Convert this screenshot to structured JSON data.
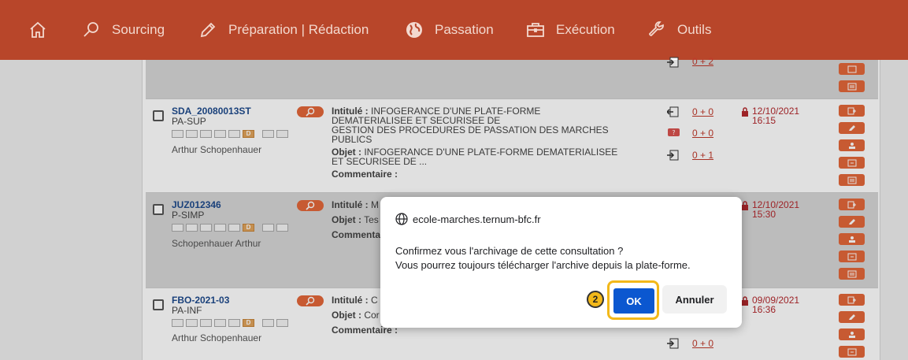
{
  "nav": {
    "items": [
      {
        "label": "Sourcing",
        "icon": "search-icon"
      },
      {
        "label": "Préparation | Rédaction",
        "icon": "pencil-icon"
      },
      {
        "label": "Passation",
        "icon": "globe-icon"
      },
      {
        "label": "Exécution",
        "icon": "briefcase-icon"
      },
      {
        "label": "Outils",
        "icon": "wrench-icon"
      }
    ]
  },
  "rows": [
    {
      "ref": "SDA_20080013ST",
      "proc": "PA-SUP",
      "author": "Arthur Schopenhauer",
      "intitule_label": "Intitulé :",
      "intitule_l1": "INFOGERANCE D'UNE PLATE-FORME",
      "intitule_l2": "DEMATERIALISEE ET SECURISEE DE",
      "intitule_l3": "GESTION DES PROCEDURES DE PASSATION DES MARCHES",
      "intitule_l4": "PUBLICS",
      "objet_label": "Objet :",
      "objet_l1": "INFOGERANCE D'UNE PLATE-FORME DEMATERIALISEE",
      "objet_l2": "ET SECURISEE DE ...",
      "comment_label": "Commentaire :",
      "counts": [
        "0 + 0",
        "0 + 0",
        "0 + 1"
      ],
      "date": "12/10/2021",
      "time": "16:15"
    },
    {
      "ref": "JUZ012346",
      "proc": "P-SIMP",
      "author": "Schopenhauer Arthur",
      "intitule_label": "Intitulé :",
      "intitule_text": "M",
      "objet_label": "Objet :",
      "objet_text": "Tes",
      "comment_label": "Commenta",
      "date": "12/10/2021",
      "time": "15:30"
    },
    {
      "ref": "FBO-2021-03",
      "proc": "PA-INF",
      "author": "Arthur Schopenhauer",
      "intitule_label": "Intitulé :",
      "intitule_text": "C",
      "objet_label": "Objet :",
      "objet_text": "Cor",
      "comment_label": "Commentaire :",
      "counts": [
        "0 + 0"
      ],
      "date": "09/09/2021",
      "time": "16:36"
    }
  ],
  "top_row_count": "0 + 2",
  "box_letter": "D",
  "dialog": {
    "origin": "ecole-marches.ternum-bfc.fr",
    "line1": "Confirmez vous l'archivage de cette consultation ?",
    "line2": "Vous pourrez toujours télécharger l'archive depuis la plate-forme.",
    "ok": "OK",
    "cancel": "Annuler"
  },
  "step_number": "2",
  "colors": {
    "nav_bg": "#b8462a",
    "accent_orange": "#e3673a",
    "ok_blue": "#0b57d0",
    "highlight": "#f2b81a"
  }
}
